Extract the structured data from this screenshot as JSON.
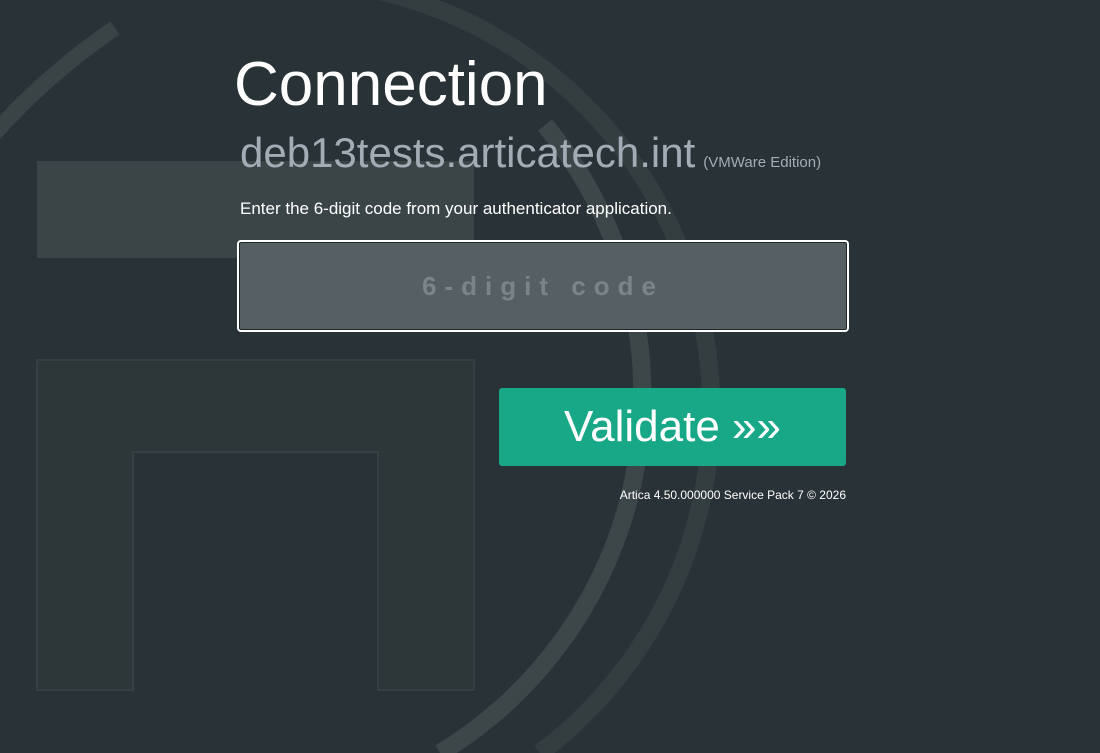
{
  "page": {
    "title": "Connection",
    "hostname": "deb13tests.articatech.int",
    "edition": "(VMWare Edition)",
    "instructions": "Enter the 6-digit code from your authenticator application."
  },
  "form": {
    "code_value": "",
    "code_placeholder": "6-digit code",
    "validate_label": "Validate »»"
  },
  "footer": {
    "version_text": "Artica 4.50.000000 Service Pack 7 © 2026"
  },
  "colors": {
    "background": "#293236",
    "accent": "#19a887",
    "muted_text": "#a3acb5",
    "input_bg": "#566064"
  }
}
